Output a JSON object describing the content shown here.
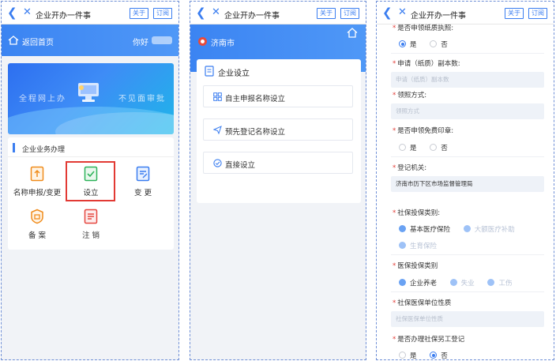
{
  "common": {
    "title": "企业开办一件事",
    "btn_about": "关于",
    "btn_subscribe": "订阅"
  },
  "panel1": {
    "home_label": "返回首页",
    "greeting": "你好",
    "banner_left": "全程网上办",
    "banner_right": "不见面审批",
    "section_title": "企业业务办理",
    "items": [
      {
        "label": "名称申报/变更",
        "icon": "document-upload-icon"
      },
      {
        "label": "设立",
        "icon": "document-check-icon"
      },
      {
        "label": "变 更",
        "icon": "document-edit-icon"
      },
      {
        "label": "备 案",
        "icon": "badge-icon"
      },
      {
        "label": "注 销",
        "icon": "document-cancel-icon"
      }
    ],
    "selected_index": 1
  },
  "panel2": {
    "city": "济南市",
    "card_title": "企业设立",
    "options": [
      {
        "label": "自主申报名称设立",
        "icon": "grid-icon"
      },
      {
        "label": "预先登记名称设立",
        "icon": "send-icon"
      },
      {
        "label": "直接设立",
        "icon": "check-circle-icon"
      }
    ]
  },
  "panel3": {
    "q1_label": "是否申领纸质执照:",
    "q1_yes": "是",
    "q1_no": "否",
    "q2_label": "申请（纸质）副本数:",
    "q2_placeholder": "申请（纸质）副本数",
    "q3_label": "领照方式:",
    "q3_placeholder": "领照方式",
    "q4_label": "是否申领免费印章:",
    "q4_yes": "是",
    "q4_no": "否",
    "q5_label": "登记机关:",
    "q5_value": "济南市历下区市场监督管理局",
    "q6_label": "社保投保类别:",
    "q6_opt1": "基本医疗保险",
    "q6_opt2": "大额医疗补助",
    "q6_opt3": "生育保险",
    "q7_label": "医保投保类别",
    "q7_opt1": "企业养老",
    "q7_opt2": "失业",
    "q7_opt3": "工伤",
    "q8_label": "社保医保单位性质",
    "q8_placeholder": "社保医保单位性质",
    "q9_label": "是否办理社保另工登记",
    "q9_yes": "是",
    "q9_no": "否"
  },
  "colors": {
    "primary": "#3a7df0",
    "header_blue": "#3b84f2",
    "highlight_red": "#e23a34",
    "required_red": "#e23a34"
  }
}
